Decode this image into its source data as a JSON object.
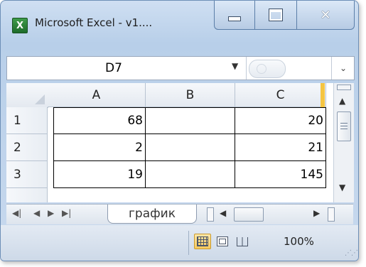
{
  "window": {
    "title": "Microsoft Excel - v1....",
    "app_icon_letter": "X"
  },
  "formula_bar": {
    "name_box": "D7",
    "formula": ""
  },
  "grid": {
    "columns": [
      "A",
      "B",
      "C"
    ],
    "rows": [
      {
        "label": "1",
        "cells": [
          "68",
          "",
          "20"
        ]
      },
      {
        "label": "2",
        "cells": [
          "2",
          "",
          "21"
        ]
      },
      {
        "label": "3",
        "cells": [
          "19",
          "",
          "145"
        ]
      }
    ]
  },
  "sheets": {
    "active_tab": "график"
  },
  "status_bar": {
    "zoom": "100%"
  },
  "colors": {
    "accent": "#f5c542",
    "title_bar": "#b8cfe9"
  },
  "icons": [
    "excel-icon",
    "minimize-icon",
    "maximize-icon",
    "close-icon",
    "dropdown-arrow-icon",
    "scroll-up-icon",
    "scroll-down-icon",
    "first-sheet-icon",
    "prev-sheet-icon",
    "next-sheet-icon",
    "last-sheet-icon",
    "normal-view-icon",
    "page-layout-icon",
    "page-break-icon"
  ]
}
